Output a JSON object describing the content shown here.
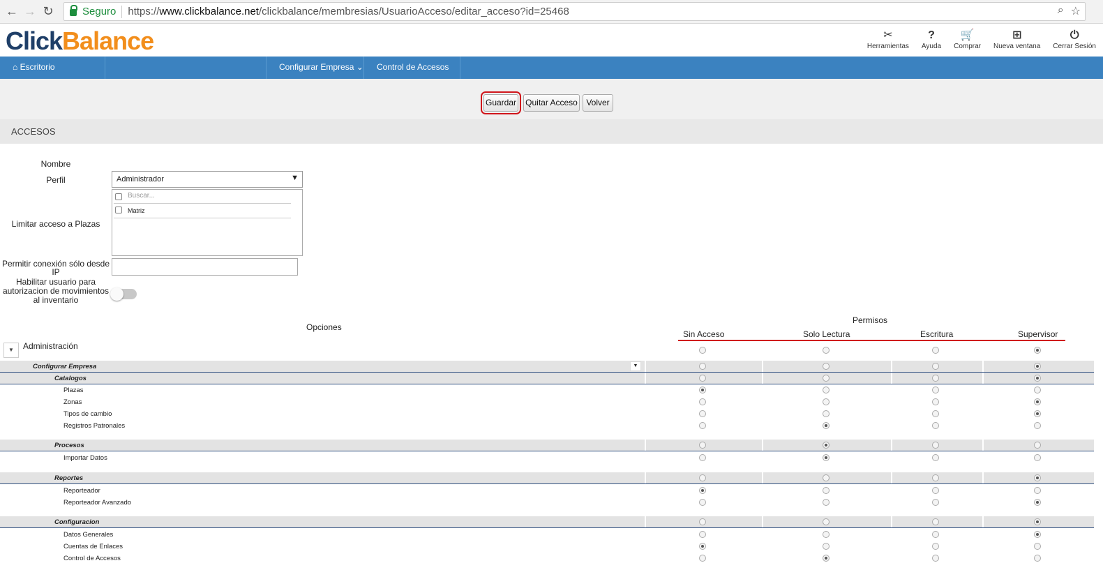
{
  "browser": {
    "secure_label": "Seguro",
    "url_prefix": "https://",
    "url_host": "www.clickbalance.net",
    "url_path": "/clickbalance/membresias/UsuarioAcceso/editar_acceso?id=25468"
  },
  "brand": {
    "part1": "Click",
    "part2": "Balance"
  },
  "tools": [
    {
      "icon": "tools-icon",
      "glyph": "✂",
      "label": "Herramientas"
    },
    {
      "icon": "help-icon",
      "glyph": "?",
      "label": "Ayuda"
    },
    {
      "icon": "cart-icon",
      "glyph": "🛒",
      "label": "Comprar"
    },
    {
      "icon": "new-window-icon",
      "glyph": "⊞",
      "label": "Nueva ventana"
    },
    {
      "icon": "power-icon",
      "glyph": "⏻",
      "label": "Cerrar Sesión"
    }
  ],
  "nav": {
    "home": "Escritorio",
    "configurar": "Configurar Empresa",
    "control": "Control de Accesos"
  },
  "actions": {
    "save": "Guardar",
    "remove": "Quitar Acceso",
    "back": "Volver"
  },
  "section_title": "ACCESOS",
  "form": {
    "nombre_label": "Nombre",
    "perfil_label": "Perfil",
    "perfil_value": "Administrador",
    "plazas_label": "Limitar acceso a Plazas",
    "plazas_search": "Buscar...",
    "plazas_items": [
      "Matriz"
    ],
    "ip_label": "Permitir conexión sólo desde IP",
    "habilitar_label": "Habilitar usuario para autorizacion de movimientos al inventario",
    "habilitar_on": false
  },
  "permissions": {
    "opciones_label": "Opciones",
    "permisos_label": "Permisos",
    "columns": [
      "Sin Acceso",
      "Solo Lectura",
      "Escritura",
      "Supervisor"
    ],
    "module": {
      "name": "Administración",
      "selected": 3
    },
    "rows": [
      {
        "name": "Configurar Empresa",
        "level": 0,
        "group": true,
        "selected": 3,
        "dropdown": true
      },
      {
        "name": "Catalogos",
        "level": 1,
        "group": true,
        "selected": 3
      },
      {
        "name": "Plazas",
        "level": 2,
        "group": false,
        "selected": 0
      },
      {
        "name": "Zonas",
        "level": 2,
        "group": false,
        "selected": 3
      },
      {
        "name": "Tipos de cambio",
        "level": 2,
        "group": false,
        "selected": 3
      },
      {
        "name": "Registros Patronales",
        "level": 2,
        "group": false,
        "selected": 1
      },
      {
        "name": "Procesos",
        "level": 1,
        "group": true,
        "selected": 1
      },
      {
        "name": "Importar Datos",
        "level": 2,
        "group": false,
        "selected": 1
      },
      {
        "name": "Reportes",
        "level": 1,
        "group": true,
        "selected": 3
      },
      {
        "name": "Reporteador",
        "level": 2,
        "group": false,
        "selected": 0
      },
      {
        "name": "Reporteador Avanzado",
        "level": 2,
        "group": false,
        "selected": 3
      },
      {
        "name": "Configuracion",
        "level": 1,
        "group": true,
        "selected": 3
      },
      {
        "name": "Datos Generales",
        "level": 2,
        "group": false,
        "selected": 3
      },
      {
        "name": "Cuentas de Enlaces",
        "level": 2,
        "group": false,
        "selected": 0
      },
      {
        "name": "Control de Accesos",
        "level": 2,
        "group": false,
        "selected": 1
      }
    ]
  }
}
